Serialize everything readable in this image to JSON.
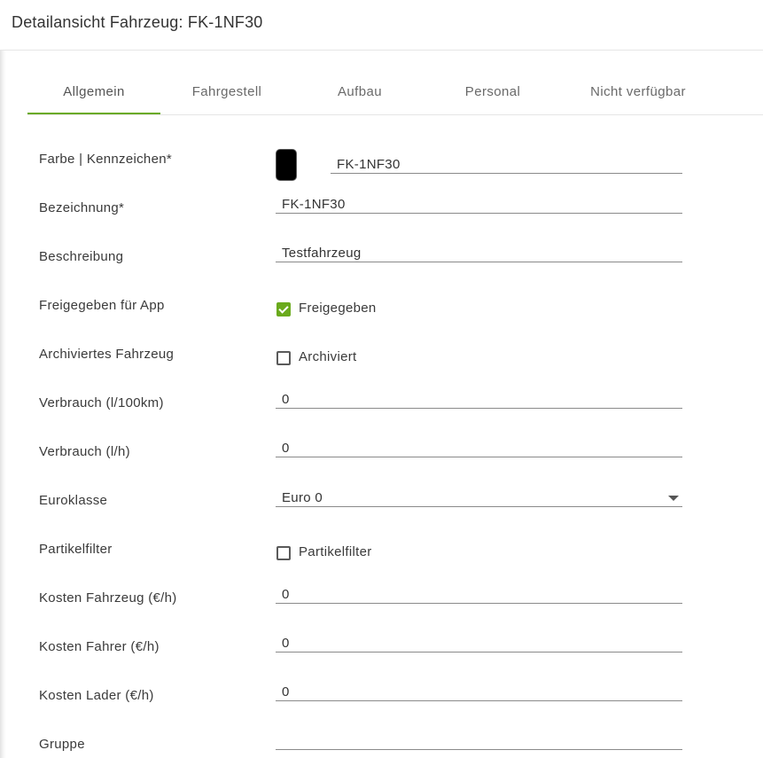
{
  "header": {
    "title": "Detailansicht Fahrzeug: FK-1NF30"
  },
  "tabs": [
    "Allgemein",
    "Fahrgestell",
    "Aufbau",
    "Personal",
    "Nicht verfügbar"
  ],
  "active_tab": "Allgemein",
  "accent_color": "#6aaa1c",
  "form": {
    "farbe_kennzeichen": {
      "label": "Farbe | Kennzeichen*",
      "color": "#000000",
      "value": "FK-1NF30"
    },
    "bezeichnung": {
      "label": "Bezeichnung*",
      "value": "FK-1NF30"
    },
    "beschreibung": {
      "label": "Beschreibung",
      "value": "Testfahrzeug"
    },
    "freigegeben": {
      "label": "Freigegeben für App",
      "checkbox_label": "Freigegeben",
      "checked": true
    },
    "archiviert": {
      "label": "Archiviertes Fahrzeug",
      "checkbox_label": "Archiviert",
      "checked": false
    },
    "verbrauch_km": {
      "label": "Verbrauch (l/100km)",
      "value": "0"
    },
    "verbrauch_h": {
      "label": "Verbrauch (l/h)",
      "value": "0"
    },
    "euroklasse": {
      "label": "Euroklasse",
      "value": "Euro 0",
      "icon": "chevron-down-icon"
    },
    "partikelfilter": {
      "label": "Partikelfilter",
      "checkbox_label": "Partikelfilter",
      "checked": false
    },
    "kosten_fahrzeug": {
      "label": "Kosten Fahrzeug (€/h)",
      "value": "0"
    },
    "kosten_fahrer": {
      "label": "Kosten Fahrer (€/h)",
      "value": "0"
    },
    "kosten_lader": {
      "label": "Kosten Lader (€/h)",
      "value": "0"
    },
    "gruppe": {
      "label": "Gruppe",
      "value": ""
    }
  }
}
